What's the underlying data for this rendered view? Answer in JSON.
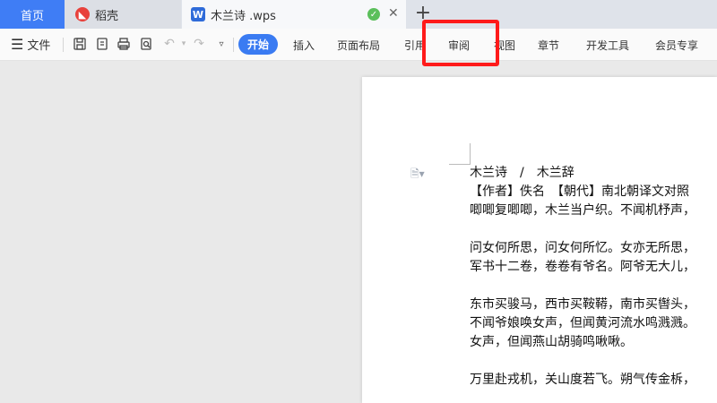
{
  "tabs": {
    "home": "首页",
    "daoke": "稻壳",
    "document": "木兰诗 .wps",
    "doc_icon": "W"
  },
  "ribbon": {
    "file_label": "文件",
    "tabs": [
      "开始",
      "插入",
      "页面布局",
      "引用",
      "审阅",
      "视图",
      "章节",
      "开发工具",
      "会员专享"
    ]
  },
  "document": {
    "lines": [
      "木兰诗　/　木兰辞",
      "【作者】佚名　【朝代】南北朝译文对照",
      "唧唧复唧唧，木兰当户织。不闻机杼声，",
      "",
      "问女何所思，问女何所忆。女亦无所思，",
      "军书十二卷，卷卷有爷名。阿爷无大儿，",
      "",
      "东市买骏马，西市买鞍鞯，南市买辔头，",
      "不闻爷娘唤女声，但闻黄河流水鸣溅溅。",
      "女声，但闻燕山胡骑鸣啾啾。",
      "",
      "万里赴戎机，关山度若飞。朔气传金柝，"
    ]
  },
  "colors": {
    "accent": "#3a7bf2",
    "highlight": "#ff1a1a"
  }
}
